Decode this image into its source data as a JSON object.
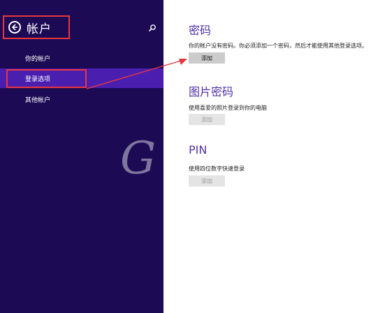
{
  "sidebar": {
    "title": "帐户",
    "items": [
      {
        "label": "你的帐户",
        "selected": false
      },
      {
        "label": "登录选项",
        "selected": true
      },
      {
        "label": "其他帐户",
        "selected": false
      }
    ]
  },
  "main": {
    "password": {
      "title": "密码",
      "description": "你的帐户没有密码。你必须添加一个密码，然后才能使用其他登录选项。",
      "button_label": "添加",
      "button_enabled": true
    },
    "picture_password": {
      "title": "图片密码",
      "description": "使用喜爱的照片登录到你的电脑",
      "button_label": "添加",
      "button_enabled": false
    },
    "pin": {
      "title": "PIN",
      "description": "使用四位数字快速登录",
      "button_label": "添加",
      "button_enabled": false
    }
  },
  "watermark": {
    "text": "G"
  },
  "colors": {
    "sidebar_bg": "#1c0a55",
    "selected_item_bg": "#4a1fb0",
    "accent_title": "#5033a8",
    "annotation_red": "#e8363f"
  },
  "icons": {
    "back": "back-arrow-icon",
    "search": "search-icon"
  }
}
